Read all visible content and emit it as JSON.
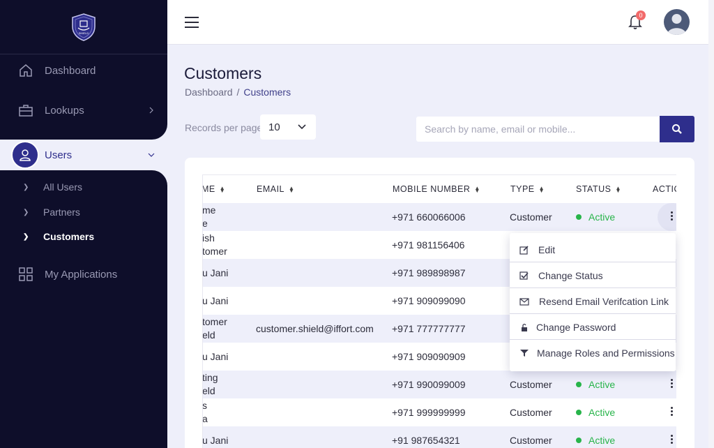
{
  "sidebar": {
    "brand": "SHIELD",
    "items": [
      {
        "label": "Dashboard"
      },
      {
        "label": "Lookups"
      },
      {
        "label": "Users"
      },
      {
        "label": "My Applications"
      }
    ],
    "user_subitems": [
      {
        "label": "All Users"
      },
      {
        "label": "Partners"
      },
      {
        "label": "Customers"
      }
    ]
  },
  "topbar": {
    "notification_count": "0"
  },
  "page": {
    "title": "Customers",
    "breadcrumb": {
      "root": "Dashboard",
      "separator": "/",
      "current": "Customers"
    }
  },
  "controls": {
    "records_label": "Records per page",
    "records_value": "10",
    "search_placeholder": "Search by name, email or mobile..."
  },
  "table": {
    "headers": {
      "name": "ME",
      "email": "EMAIL",
      "mobile": "MOBILE NUMBER",
      "type": "TYPE",
      "status": "STATUS",
      "actions": "ACTIO"
    },
    "rows": [
      {
        "name_l1": "me",
        "name_l2": "e",
        "email": "",
        "mobile": "+971 660066006",
        "type": "Customer",
        "status": "Active"
      },
      {
        "name_l1": "ish",
        "name_l2": "tomer",
        "email": "",
        "mobile": "+971 981156406",
        "type": "",
        "status": ""
      },
      {
        "name_l1": "u Jani",
        "name_l2": "",
        "email": "",
        "mobile": "+971 989898987",
        "type": "",
        "status": ""
      },
      {
        "name_l1": "u Jani",
        "name_l2": "",
        "email": "",
        "mobile": "+971 909099090",
        "type": "",
        "status": ""
      },
      {
        "name_l1": "tomer",
        "name_l2": "eld",
        "email": "customer.shield@iffort.com",
        "mobile": "+971 777777777",
        "type": "",
        "status": ""
      },
      {
        "name_l1": "u Jani",
        "name_l2": "",
        "email": "",
        "mobile": "+971 909090909",
        "type": "",
        "status": ""
      },
      {
        "name_l1": "ting",
        "name_l2": "eld",
        "email": "",
        "mobile": "+971 990099009",
        "type": "Customer",
        "status": "Active"
      },
      {
        "name_l1": "s",
        "name_l2": "a",
        "email": "",
        "mobile": "+971 999999999",
        "type": "Customer",
        "status": "Active"
      },
      {
        "name_l1": "u Jani",
        "name_l2": "",
        "email": "",
        "mobile": "+91 987654321",
        "type": "Customer",
        "status": "Active"
      }
    ]
  },
  "action_menu": {
    "items": [
      {
        "label": "Edit",
        "icon": "edit-icon"
      },
      {
        "label": "Change Status",
        "icon": "checkbox-icon"
      },
      {
        "label": "Resend Email Verifcation Link",
        "icon": "envelope-icon"
      },
      {
        "label": "Change Password",
        "icon": "lock-icon"
      },
      {
        "label": "Manage Roles and Permissions",
        "icon": "filter-icon"
      }
    ]
  },
  "colors": {
    "sidebar_bg": "#0e0e2a",
    "accent": "#2e2e8c",
    "page_bg": "#eeeffa",
    "active_green": "#28b44a",
    "badge_red": "#f26a6a"
  }
}
